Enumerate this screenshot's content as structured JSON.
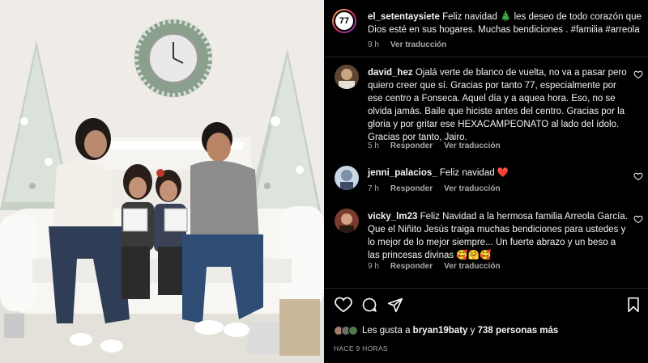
{
  "post": {
    "author": "el_setentaysiete",
    "avatar_text": "77",
    "caption_prefix": "Feliz navidad",
    "caption_emoji": "🎄",
    "caption_rest": "les deseo de todo corazón que Dios esté en sus hogares. Muchas bendiciones . #familia #arreola",
    "time": "9 h",
    "translate": "Ver traducción"
  },
  "comments": [
    {
      "user": "david_hez",
      "text": "Ojalá verte de blanco de vuelta, no va a pasar pero quiero creer que sí. Gracias por tanto 77, especialmente por ese centro a Fonseca. Aquel día y a aquea hora. Eso, no se olvida jamás. Baile que hiciste antes del centro. Gracias por la gloria y por gritar ese HEXACAMPEONATO al lado del ídolo. Gracias por tanto, Jairo.",
      "time": "5 h",
      "reply": "Responder",
      "translate": "Ver traducción"
    },
    {
      "user": "jenni_palacios_",
      "text": "Feliz navidad ❤️",
      "time": "7 h",
      "reply": "Responder",
      "translate": "Ver traducción"
    },
    {
      "user": "vicky_lm23",
      "text": "Feliz Navidad a la hermosa familia Arreola García. Que el Niñito Jesús traiga muchas bendiciones para ustedes y lo mejor de lo mejor siempre... Un fuerte abrazo y un beso a las princesas divinas 🥰🤗🥰",
      "time": "9 h",
      "reply": "Responder",
      "translate": "Ver traducción"
    }
  ],
  "likes": {
    "prefix": "Les gusta a",
    "user": "bryan19baty",
    "connector": "y",
    "others": "738 personas más"
  },
  "posted_ago": "HACE 9 HORAS",
  "icons": {
    "like": "heart-icon",
    "comment": "comment-icon",
    "share": "send-icon",
    "save": "bookmark-icon"
  },
  "colors": {
    "background": "#000000",
    "text": "#f5f5f5",
    "muted": "#a8a8a8",
    "heart_red": "#ed4956"
  }
}
